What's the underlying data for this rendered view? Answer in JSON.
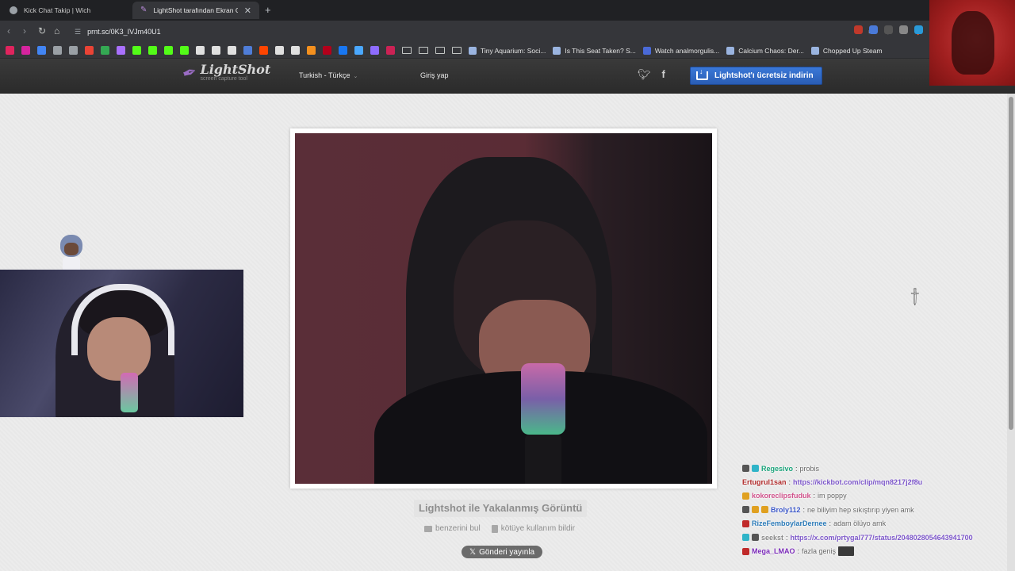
{
  "browser": {
    "tabs": [
      {
        "title": "Kick Chat Takip | Wich",
        "active": false
      },
      {
        "title": "LightShot tarafından Ekran Görü",
        "active": true
      }
    ],
    "url": "prnt.sc/0K3_IVJm40U1",
    "bookmarks": [
      "Tiny Aquarium: Soci...",
      "Is This Seat Taken? S...",
      "Watch analmorgulis...",
      "Calcium Chaos: Der...",
      "Chopped Up Steam"
    ],
    "bookmark_icon_colors": [
      "#e0245e",
      "#d6249f",
      "#4285f4",
      "#9aa0a6",
      "#9aa0a6",
      "#ea4335",
      "#34a853",
      "#a970ff",
      "#53fc18",
      "#53fc18",
      "#53fc18",
      "#53fc18",
      "#e0e0e0",
      "#e0e0e0",
      "#e0e0e0",
      "#4f7dd8",
      "#ff4500",
      "#e0e0e0",
      "#e0e0e0",
      "#f4901e",
      "#b3001b",
      "#1877f2",
      "#4aa8ff",
      "#8e6cff",
      "#cc2255"
    ]
  },
  "lightshot": {
    "logo_title": "LightShot",
    "logo_subtitle": "screen capture tool",
    "language": "Turkish - Türkçe",
    "login": "Giriş yap",
    "download_button": "Lightshot'ı ücretsiz indirin",
    "screenshot_title": "Lightshot ile Yakalanmış Görüntü",
    "find_similar": "benzerini bul",
    "report_abuse": "kötüye kullanım bildir",
    "post_button": "Gönderi yayınla"
  },
  "chat": [
    {
      "user": "Regesivo",
      "color": "#1aa37a",
      "message": "probis",
      "link": false,
      "badges": [
        "#555555",
        "#2fb4c8"
      ]
    },
    {
      "user": "Ertugrul1san",
      "color": "#b02a2a",
      "message": "https://kickbot.com/clip/mqn8217j2f8u",
      "link": true,
      "badges": []
    },
    {
      "user": "kokoreclipsfuduk",
      "color": "#d0508a",
      "message": "im poppy",
      "link": false,
      "badges": [
        "#e0a020"
      ]
    },
    {
      "user": "Broly112",
      "color": "#3a56c8",
      "message": "ne biliyim hep sıkıştırıp yiyen amk",
      "link": false,
      "badges": [
        "#555555",
        "#e0a020",
        "#e0a020"
      ]
    },
    {
      "user": "RizeFemboylarDernee",
      "color": "#2a7ab8",
      "message": "adam ölüyo amk",
      "link": false,
      "badges": [
        "#c02a2a"
      ]
    },
    {
      "user": "seekst",
      "color": "#888888",
      "message": "https://x.com/prtygal777/status/2048028054643941700",
      "link": true,
      "badges": [
        "#2fb4c8",
        "#555555"
      ]
    },
    {
      "user": "Mega_LMAO",
      "color": "#7a2ab8",
      "message": "fazla geniş",
      "link": false,
      "badges": [
        "#c02a2a"
      ]
    }
  ],
  "colors": {
    "download_button": "#2f6bd0",
    "lightshot_header": "#333333",
    "page_background": "#ececec"
  }
}
